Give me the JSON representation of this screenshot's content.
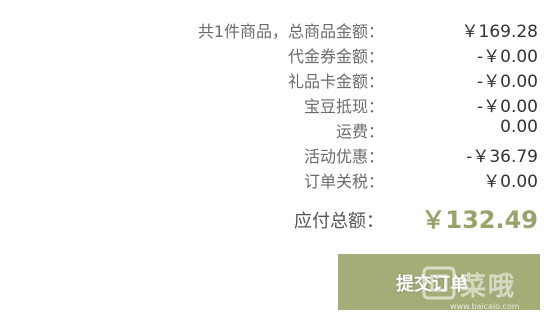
{
  "summary": {
    "rows": [
      {
        "label": "共1件商品，总商品金额：",
        "value": "￥169.28"
      },
      {
        "label": "代金券金额：",
        "value": "-￥0.00"
      },
      {
        "label": "礼品卡金额：",
        "value": "-￥0.00"
      },
      {
        "label": "宝豆抵现：",
        "value": "-￥0.00"
      },
      {
        "label": "运费：",
        "value": "0.00"
      },
      {
        "label": "活动优惠：",
        "value": "-￥36.79"
      },
      {
        "label": "订单关税：",
        "value": "￥0.00"
      }
    ],
    "total_label": "应付总额：",
    "total_value": "￥132.49"
  },
  "actions": {
    "submit_label": "提交订单"
  },
  "watermark": {
    "text": "菜哦",
    "sub": "www.baicaio.com"
  },
  "colors": {
    "accent": "#97a36a",
    "button": "#a2ad78"
  }
}
